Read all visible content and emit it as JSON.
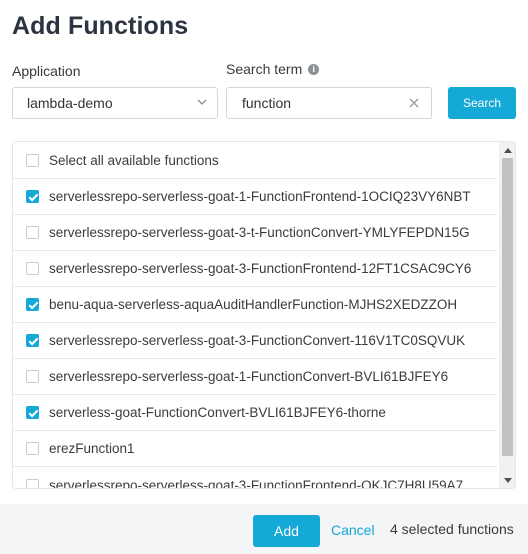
{
  "dialog": {
    "title": "Add Functions"
  },
  "application": {
    "label": "Application",
    "selected": "lambda-demo"
  },
  "search": {
    "label": "Search term",
    "value": "function",
    "button_label": "Search"
  },
  "list": {
    "select_all_label": "Select all available functions",
    "select_all_checked": false,
    "items": [
      {
        "label": "serverlessrepo-serverless-goat-1-FunctionFrontend-1OCIQ23VY6NBT",
        "checked": true
      },
      {
        "label": "serverlessrepo-serverless-goat-3-t-FunctionConvert-YMLYFEPDN15G",
        "checked": false
      },
      {
        "label": "serverlessrepo-serverless-goat-3-FunctionFrontend-12FT1CSAC9CY6",
        "checked": false
      },
      {
        "label": "benu-aqua-serverless-aquaAuditHandlerFunction-MJHS2XEDZZOH",
        "checked": true
      },
      {
        "label": "serverlessrepo-serverless-goat-3-FunctionConvert-116V1TC0SQVUK",
        "checked": true
      },
      {
        "label": "serverlessrepo-serverless-goat-1-FunctionConvert-BVLI61BJFEY6",
        "checked": false
      },
      {
        "label": "serverless-goat-FunctionConvert-BVLI61BJFEY6-thorne",
        "checked": true
      },
      {
        "label": "erezFunction1",
        "checked": false
      },
      {
        "label": "serverlessrepo-serverless-goat-3-FunctionFrontend-QKJC7H8U59A7",
        "checked": false
      }
    ]
  },
  "footer": {
    "add_label": "Add",
    "cancel_label": "Cancel",
    "selected_count_text": "4 selected functions"
  },
  "colors": {
    "accent": "#14a9d6",
    "footer_bg": "#f3f5f7"
  }
}
